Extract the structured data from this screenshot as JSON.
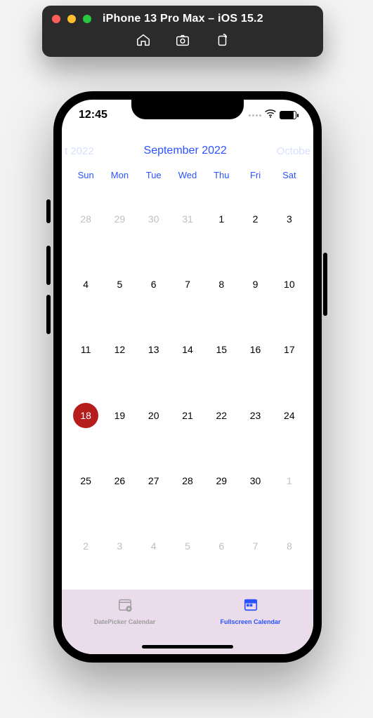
{
  "simulator": {
    "title": "iPhone 13 Pro Max – iOS 15.2"
  },
  "statusbar": {
    "time": "12:45"
  },
  "calendar": {
    "prev_month_hint": "t 2022",
    "current_month": "September 2022",
    "next_month_hint": "Octobe",
    "day_names": [
      "Sun",
      "Mon",
      "Tue",
      "Wed",
      "Thu",
      "Fri",
      "Sat"
    ],
    "weeks": [
      [
        {
          "n": "28",
          "other": true
        },
        {
          "n": "29",
          "other": true
        },
        {
          "n": "30",
          "other": true
        },
        {
          "n": "31",
          "other": true
        },
        {
          "n": "1"
        },
        {
          "n": "2"
        },
        {
          "n": "3"
        }
      ],
      [
        {
          "n": "4"
        },
        {
          "n": "5"
        },
        {
          "n": "6"
        },
        {
          "n": "7"
        },
        {
          "n": "8"
        },
        {
          "n": "9"
        },
        {
          "n": "10"
        }
      ],
      [
        {
          "n": "11"
        },
        {
          "n": "12"
        },
        {
          "n": "13"
        },
        {
          "n": "14"
        },
        {
          "n": "15"
        },
        {
          "n": "16"
        },
        {
          "n": "17"
        }
      ],
      [
        {
          "n": "18",
          "today": true
        },
        {
          "n": "19"
        },
        {
          "n": "20"
        },
        {
          "n": "21"
        },
        {
          "n": "22"
        },
        {
          "n": "23"
        },
        {
          "n": "24"
        }
      ],
      [
        {
          "n": "25"
        },
        {
          "n": "26"
        },
        {
          "n": "27"
        },
        {
          "n": "28"
        },
        {
          "n": "29"
        },
        {
          "n": "30"
        },
        {
          "n": "1",
          "other": true
        }
      ],
      [
        {
          "n": "2",
          "other": true
        },
        {
          "n": "3",
          "other": true
        },
        {
          "n": "4",
          "other": true
        },
        {
          "n": "5",
          "other": true
        },
        {
          "n": "6",
          "other": true
        },
        {
          "n": "7",
          "other": true
        },
        {
          "n": "8",
          "other": true
        }
      ]
    ]
  },
  "tabs": {
    "left": "DatePicker Calendar",
    "right": "Fullscreen Calendar"
  },
  "colors": {
    "accent": "#2a52ff",
    "today": "#b61e1e"
  }
}
